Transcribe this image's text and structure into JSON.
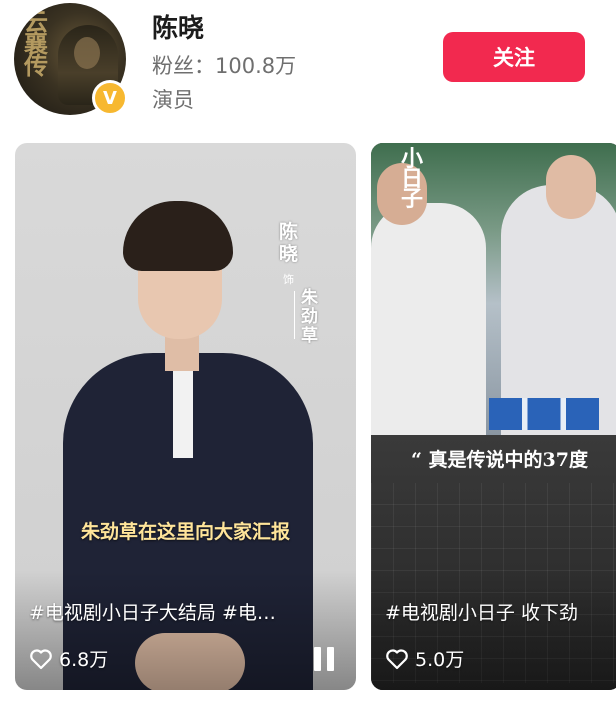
{
  "profile": {
    "avatar_text": "云襄传",
    "name": "陈晓",
    "fans": "粉丝：100.8万",
    "role": "演员",
    "badge_icon": "verified-v-icon",
    "badge_letter": "V",
    "badge_color": "#f7b830"
  },
  "follow_button": {
    "label": "关注",
    "color": "#f2294f"
  },
  "videos": [
    {
      "vertical_name": "陈晓",
      "vertical_as": "饰",
      "vertical_role": "朱劲草",
      "subtitle": "朱劲草在这里向大家汇报",
      "title": "#电视剧小日子大结局 #电…",
      "likes": "6.8万",
      "state_icon": "pause-icon"
    },
    {
      "logo_text": "小日子",
      "subtitle": "“ 真是传说中的37度",
      "title": "#电视剧小日子 收下劲",
      "likes": "5.0万"
    }
  ]
}
